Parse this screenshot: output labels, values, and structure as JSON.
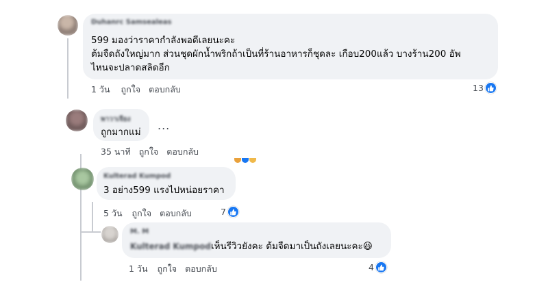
{
  "comments": [
    {
      "author": "Duhanrc Samsealeas",
      "lines": [
        "599 มองว่าราคากำลังพอดีเลยนะคะ",
        "ต้มจืดถังใหญ่มาก ส่วนชุดผักน้ำพริกถ้าเป็นที่ร้านอาหารก็ชุดละ เกือบ200แล้ว บางร้าน200 อัพ",
        "ไหนจะปลาดสลิดอีก"
      ],
      "time": "1 วัน",
      "like": "ถูกใจ",
      "reply": "ตอบกลับ",
      "reactions": "13"
    },
    {
      "author": "พาวาเจียง",
      "lines": [
        "ถูกมากแม่"
      ],
      "more": "...",
      "time": "35 นาที",
      "like": "ถูกใจ",
      "reply": "ตอบกลับ"
    },
    {
      "author": "Kulterad Kumpod",
      "lines": [
        "3 อย่าง599 แรงไปหน่อยราคา"
      ],
      "time": "5 วัน",
      "like": "ถูกใจ",
      "reply": "ตอบกลับ",
      "reactions": "7"
    },
    {
      "author": "M. M",
      "mention": "Kulterad Kumpod",
      "lines": [
        "เห็นรีวิวยังคะ ต้มจืดมาเป็นถังเลยนะคะ😆"
      ],
      "time": "1 วัน",
      "like": "ถูกใจ",
      "reply": "ตอบกลับ",
      "reactions": "4"
    }
  ],
  "colors": {
    "bubble": "#f0f2f5",
    "like_blue": "#1877f2",
    "meta_text": "#444950"
  }
}
